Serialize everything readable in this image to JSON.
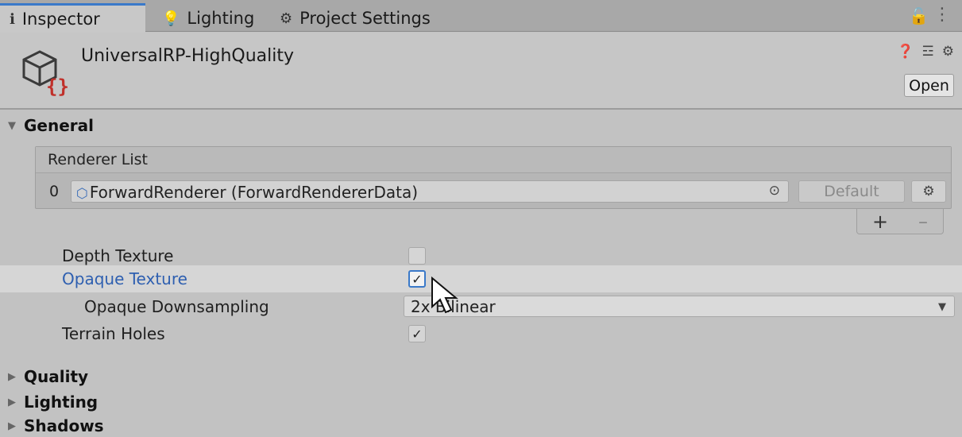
{
  "tabs": [
    {
      "label": "Inspector",
      "icon": "info-icon",
      "active": true
    },
    {
      "label": "Lighting",
      "icon": "lightbulb-icon",
      "active": false
    },
    {
      "label": "Project Settings",
      "icon": "gear-icon",
      "active": false
    }
  ],
  "tabbar_icons": {
    "lock": "lock-icon",
    "menu": "kebab-menu-icon"
  },
  "header": {
    "title": "UniversalRP-HighQuality",
    "icons": [
      "help-icon",
      "preset-icon",
      "settings-icon"
    ],
    "open_label": "Open"
  },
  "sections": {
    "general": "General",
    "quality": "Quality",
    "lighting": "Lighting",
    "shadows": "Shadows"
  },
  "renderer_list": {
    "header": "Renderer List",
    "rows": [
      {
        "index": "0",
        "object": "ForwardRenderer (ForwardRendererData)",
        "default_label": "Default"
      }
    ],
    "add_label": "+",
    "remove_label": "–"
  },
  "properties": {
    "depth_texture": {
      "label": "Depth Texture",
      "checked": false
    },
    "opaque_texture": {
      "label": "Opaque Texture",
      "checked": true
    },
    "opaque_downsampling": {
      "label": "Opaque Downsampling",
      "value": "2x Bilinear"
    },
    "terrain_holes": {
      "label": "Terrain Holes",
      "checked": true
    }
  },
  "colors": {
    "accent": "#3a79c9",
    "label_highlight": "#2e5fb0",
    "panel_bg": "#c2c2c2"
  }
}
